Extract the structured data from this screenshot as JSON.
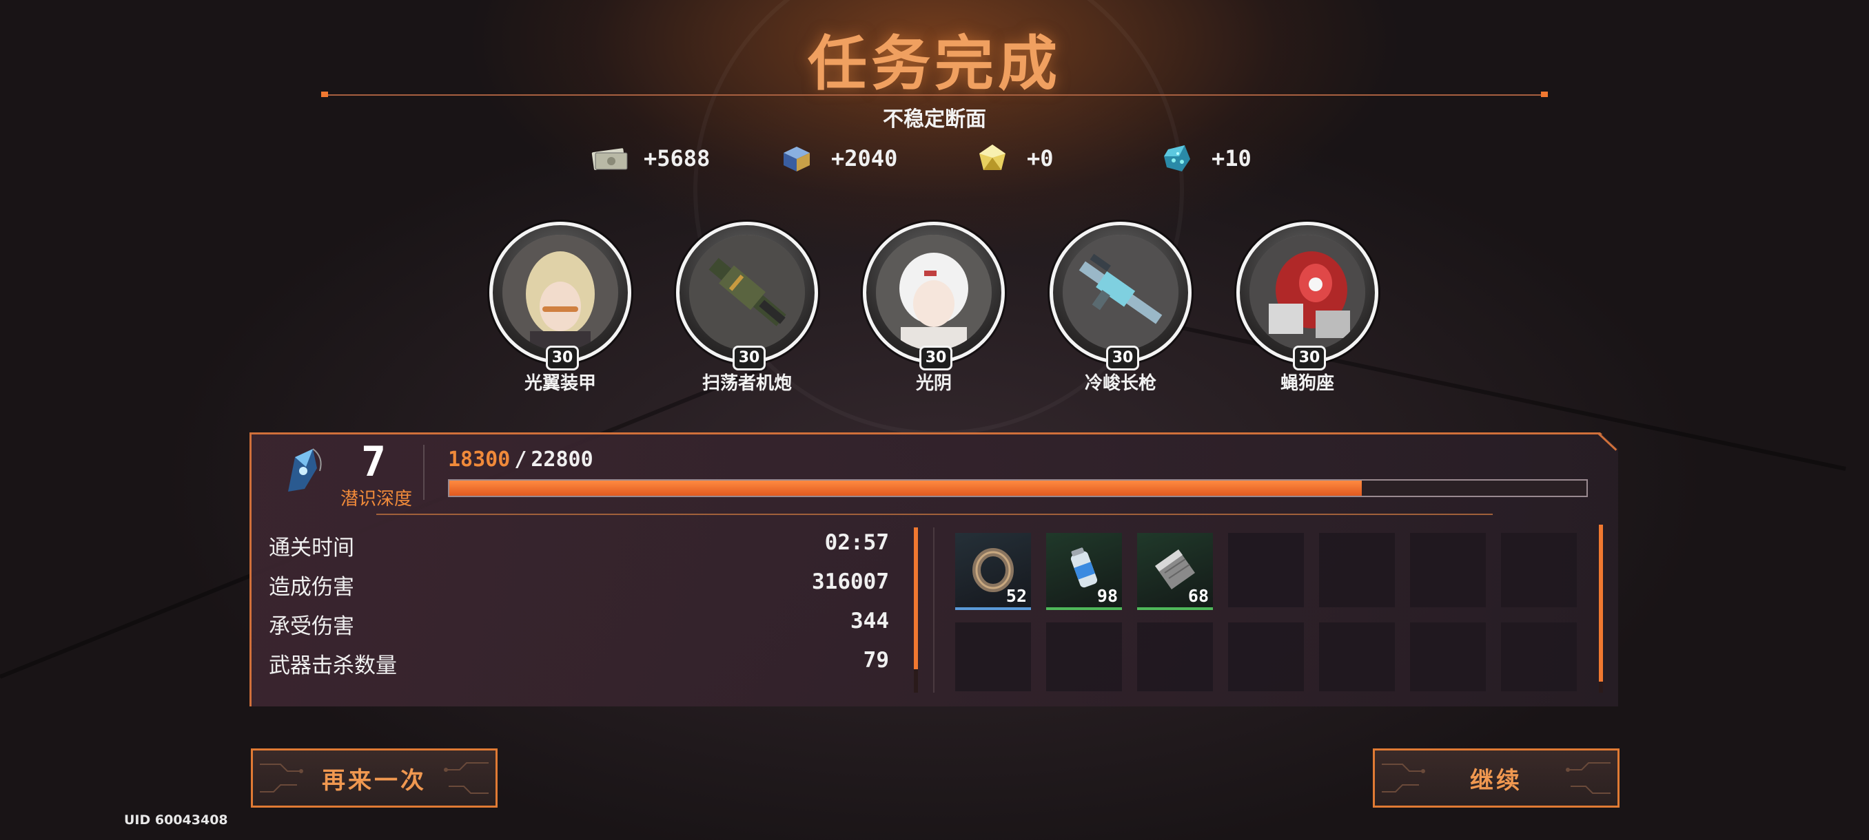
{
  "header": {
    "title": "任务完成",
    "stage_name": "不稳定断面"
  },
  "rewards": [
    {
      "icon": "cash-icon",
      "value": "+5688"
    },
    {
      "icon": "exp-cube-icon",
      "value": "+2040"
    },
    {
      "icon": "gold-crystal-icon",
      "value": "+0"
    },
    {
      "icon": "blue-ore-icon",
      "value": "+10"
    }
  ],
  "team": [
    {
      "name": "光翼装甲",
      "level": "30"
    },
    {
      "name": "扫荡者机炮",
      "level": "30"
    },
    {
      "name": "光阴",
      "level": "30"
    },
    {
      "name": "冷峻长枪",
      "level": "30"
    },
    {
      "name": "蝇狗座",
      "level": "30"
    }
  ],
  "depth": {
    "value": "7",
    "label": "潜识深度",
    "current": "18300",
    "separator": "/",
    "max": "22800",
    "progress": 0.8026
  },
  "stats": [
    {
      "label": "通关时间",
      "value": "02:57"
    },
    {
      "label": "造成伤害",
      "value": "316007"
    },
    {
      "label": "承受伤害",
      "value": "344"
    },
    {
      "label": "武器击杀数量",
      "value": "79"
    }
  ],
  "inventory": [
    {
      "icon": "ring-icon",
      "count": "52",
      "rarity": "blue"
    },
    {
      "icon": "battery-canister-icon",
      "count": "98",
      "rarity": "green"
    },
    {
      "icon": "metal-plate-icon",
      "count": "68",
      "rarity": "green"
    }
  ],
  "buttons": {
    "retry": "再来一次",
    "continue": "继续"
  },
  "uid": "UID 60043408"
}
